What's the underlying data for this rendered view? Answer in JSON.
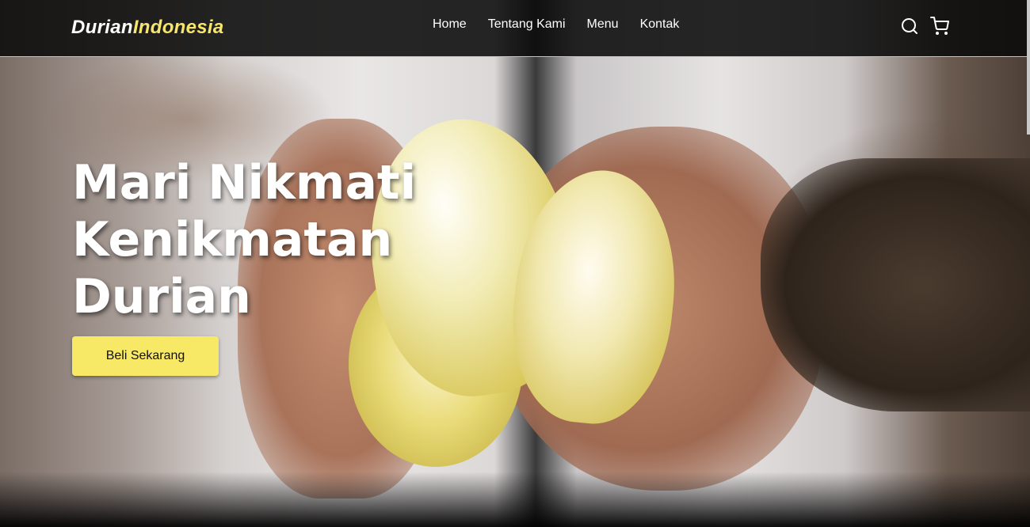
{
  "brand": {
    "name_part1": "Durian",
    "name_part2": "Indonesia"
  },
  "nav": {
    "items": [
      {
        "label": "Home"
      },
      {
        "label": "Tentang Kami"
      },
      {
        "label": "Menu"
      },
      {
        "label": "Kontak"
      }
    ],
    "icons": [
      "search-icon",
      "shopping-cart-icon"
    ]
  },
  "hero": {
    "title_lines": [
      "Mari Nikmati",
      "Kenikmatan",
      "Durian"
    ],
    "cta_label": "Beli Sekarang"
  },
  "colors": {
    "accent": "#f7e865",
    "navbar_bg": "#0a0a0a",
    "text": "#ffffff"
  }
}
